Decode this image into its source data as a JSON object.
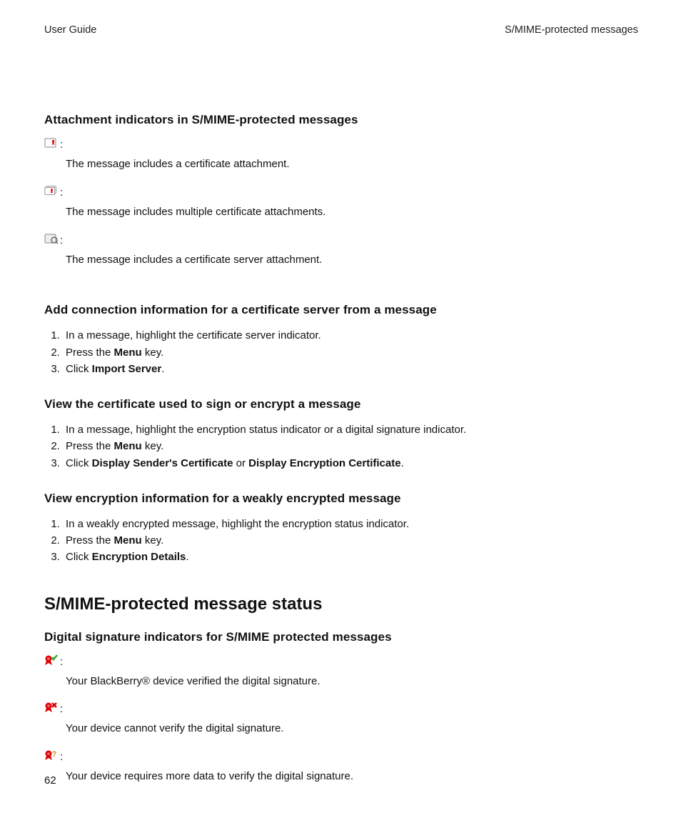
{
  "header": {
    "left": "User Guide",
    "right": "S/MIME-protected messages"
  },
  "attachment_indicators": {
    "heading": "Attachment indicators in S/MIME-protected messages",
    "items": [
      {
        "desc": "The message includes a certificate attachment."
      },
      {
        "desc": "The message includes multiple certificate attachments."
      },
      {
        "desc": "The message includes a certificate server attachment."
      }
    ]
  },
  "add_connection": {
    "heading": "Add connection information for a certificate server from a message",
    "steps": {
      "s1": "In a message, highlight the certificate server indicator.",
      "s2a": "Press the ",
      "s2b": "Menu",
      "s2c": " key.",
      "s3a": "Click ",
      "s3b": "Import Server",
      "s3c": "."
    }
  },
  "view_cert": {
    "heading": "View the certificate used to sign or encrypt a message",
    "steps": {
      "s1": "In a message, highlight the encryption status indicator or a digital signature indicator.",
      "s2a": "Press the ",
      "s2b": "Menu",
      "s2c": " key.",
      "s3a": "Click ",
      "s3b": "Display Sender's Certificate",
      "s3c": " or ",
      "s3d": "Display Encryption Certificate",
      "s3e": "."
    }
  },
  "view_enc": {
    "heading": "View encryption information for a weakly encrypted message",
    "steps": {
      "s1": "In a weakly encrypted message, highlight the encryption status indicator.",
      "s2a": "Press the ",
      "s2b": "Menu",
      "s2c": " key.",
      "s3a": "Click ",
      "s3b": "Encryption Details",
      "s3c": "."
    }
  },
  "status_section": {
    "heading": "S/MIME-protected message status"
  },
  "signature_indicators": {
    "heading": "Digital signature indicators for S/MIME protected messages",
    "items": [
      {
        "desc": "Your BlackBerry® device verified the digital signature."
      },
      {
        "desc": "Your device cannot verify the digital signature."
      },
      {
        "desc": "Your device requires more data to verify the digital signature."
      }
    ]
  },
  "colon": ":",
  "page_number": "62"
}
